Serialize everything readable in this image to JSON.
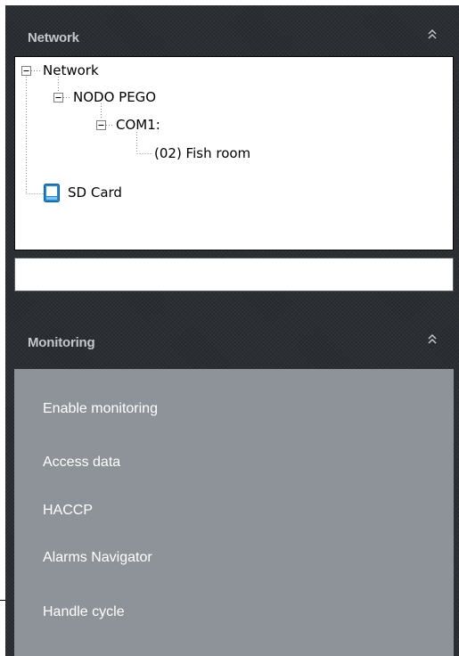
{
  "network_section": {
    "title": "Network",
    "collapse_icon": "double-chevron-up-icon"
  },
  "tree": {
    "nodes": [
      {
        "label": "Network",
        "expander": "minus",
        "icon": null
      },
      {
        "label": "NODO PEGO",
        "expander": "minus",
        "icon": null
      },
      {
        "label": "COM1:",
        "expander": "minus",
        "icon": null
      },
      {
        "label": "(02) Fish room",
        "expander": null,
        "icon": null
      },
      {
        "label": "SD Card",
        "expander": null,
        "icon": "sd-card-icon"
      }
    ]
  },
  "search": {
    "value": "",
    "placeholder": ""
  },
  "monitoring_section": {
    "title": "Monitoring",
    "collapse_icon": "double-chevron-up-icon",
    "items": [
      {
        "label": "Enable monitoring"
      },
      {
        "label": "Access data"
      },
      {
        "label": "HACCP"
      },
      {
        "label": "Alarms Navigator"
      },
      {
        "label": "Handle cycle"
      }
    ]
  },
  "colors": {
    "frame_background": "#2b2f33",
    "header_text": "#c3c7cb",
    "monitoring_panel": "#8d9398",
    "menu_text": "#ffffff",
    "tree_background": "#ffffff",
    "sd_card_icon": "#1e88d6"
  }
}
